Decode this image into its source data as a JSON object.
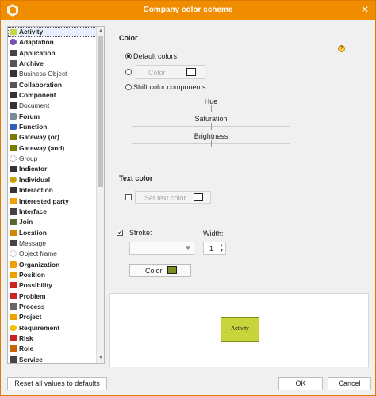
{
  "window": {
    "title": "Company color scheme"
  },
  "list": {
    "items": [
      {
        "label": "Activity",
        "style": "bold",
        "icon": "activity-icon",
        "color": "#c9d43a",
        "selected": true
      },
      {
        "label": "Adaptation",
        "style": "bold",
        "icon": "adaptation-icon",
        "color": "#7b4fb0"
      },
      {
        "label": "Application",
        "style": "bold",
        "icon": "application-icon",
        "color": "#444444"
      },
      {
        "label": "Archive",
        "style": "bold",
        "icon": "archive-icon",
        "color": "#555555"
      },
      {
        "label": "Business Object",
        "style": "plain",
        "icon": "business-object-icon",
        "color": "#333333"
      },
      {
        "label": "Collaboration",
        "style": "bold",
        "icon": "collaboration-icon",
        "color": "#555555"
      },
      {
        "label": "Component",
        "style": "bold",
        "icon": "component-icon",
        "color": "#333333"
      },
      {
        "label": "Document",
        "style": "plain",
        "icon": "document-icon",
        "color": "#333333"
      },
      {
        "label": "Forum",
        "style": "bold",
        "icon": "forum-icon",
        "color": "#7a8a9a"
      },
      {
        "label": "Function",
        "style": "bold",
        "icon": "function-icon",
        "color": "#2f5fb8"
      },
      {
        "label": "Gateway (or)",
        "style": "bold",
        "icon": "gateway-or-icon",
        "color": "#7a7a00"
      },
      {
        "label": "Gateway (and)",
        "style": "bold",
        "icon": "gateway-and-icon",
        "color": "#7a7a00"
      },
      {
        "label": "Group",
        "style": "plain",
        "icon": "group-icon",
        "color": "#888888"
      },
      {
        "label": "Indicator",
        "style": "bold",
        "icon": "indicator-icon",
        "color": "#333333"
      },
      {
        "label": "Individual",
        "style": "bold",
        "icon": "individual-icon",
        "color": "#c8a000"
      },
      {
        "label": "Interaction",
        "style": "bold",
        "icon": "interaction-icon",
        "color": "#333333"
      },
      {
        "label": "Interested party",
        "style": "bold",
        "icon": "interested-party-icon",
        "color": "#f0a000"
      },
      {
        "label": "Interface",
        "style": "bold",
        "icon": "interface-icon",
        "color": "#444444"
      },
      {
        "label": "Join",
        "style": "bold",
        "icon": "join-icon",
        "color": "#556b2f"
      },
      {
        "label": "Location",
        "style": "bold",
        "icon": "location-icon",
        "color": "#cc8800"
      },
      {
        "label": "Message",
        "style": "plain",
        "icon": "message-icon",
        "color": "#444444"
      },
      {
        "label": "Object frame",
        "style": "plain",
        "icon": "object-frame-icon",
        "color": "#999999"
      },
      {
        "label": "Organization",
        "style": "bold",
        "icon": "organization-icon",
        "color": "#f0a000"
      },
      {
        "label": "Position",
        "style": "bold",
        "icon": "position-icon",
        "color": "#f0a000"
      },
      {
        "label": "Possibility",
        "style": "bold",
        "icon": "possibility-icon",
        "color": "#cc2222"
      },
      {
        "label": "Problem",
        "style": "bold",
        "icon": "problem-icon",
        "color": "#cc2222"
      },
      {
        "label": "Process",
        "style": "bold",
        "icon": "process-icon",
        "color": "#666666"
      },
      {
        "label": "Project",
        "style": "bold",
        "icon": "project-icon",
        "color": "#f0a000"
      },
      {
        "label": "Requirement",
        "style": "bold",
        "icon": "requirement-icon",
        "color": "#f0c000"
      },
      {
        "label": "Risk",
        "style": "bold",
        "icon": "risk-icon",
        "color": "#cc2222"
      },
      {
        "label": "Role",
        "style": "bold",
        "icon": "role-icon",
        "color": "#c86400"
      },
      {
        "label": "Service",
        "style": "bold",
        "icon": "service-icon",
        "color": "#444444"
      }
    ]
  },
  "color_section": {
    "title": "Color",
    "default_colors": "Default colors",
    "color_button": "Color",
    "shift_components": "Shift color components",
    "sliders": [
      "Hue",
      "Saturation",
      "Brightness"
    ]
  },
  "text_color_section": {
    "title": "Text color",
    "set_text_color": "Set text color..."
  },
  "stroke_section": {
    "stroke_label": "Stroke:",
    "width_label": "Width:",
    "width_value": "1",
    "color_button": "Color",
    "stroke_color": "#7f8f1f"
  },
  "preview": {
    "shape_label": "Activity",
    "fill_color": "#c9d43a"
  },
  "buttons": {
    "reset": "Reset all values to defaults",
    "ok": "OK",
    "cancel": "Cancel"
  },
  "colors": {
    "title_bar": "#f08c00"
  }
}
